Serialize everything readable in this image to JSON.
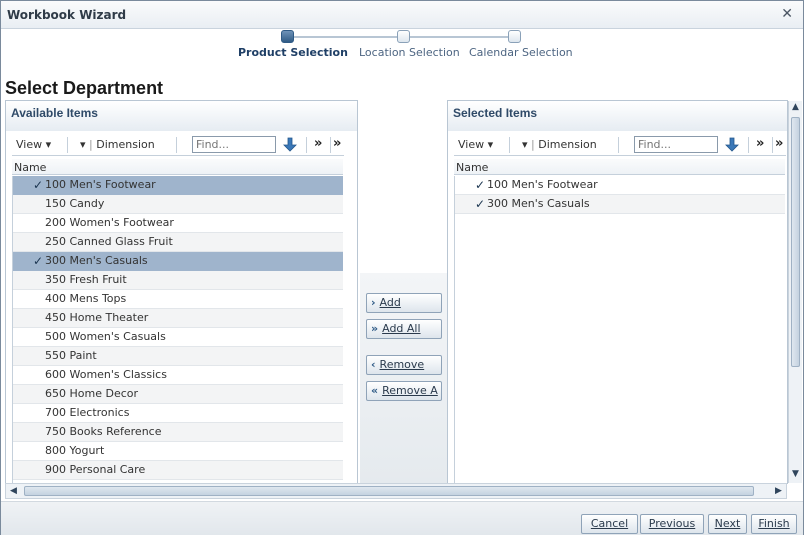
{
  "window": {
    "title": "Workbook Wizard",
    "close_symbol": "✕"
  },
  "train": {
    "steps": [
      {
        "label": "Product Selection",
        "active": true
      },
      {
        "label": "Location Selection",
        "active": false
      },
      {
        "label": "Calendar Selection",
        "active": false
      }
    ]
  },
  "page_title": "Select Department",
  "available": {
    "title": "Available Items",
    "toolbar": {
      "view": "View",
      "dimension": "Dimension",
      "find_placeholder": "Find...",
      "more": "»"
    },
    "column": "Name",
    "items": [
      {
        "label": "100 Men's Footwear",
        "checked": true
      },
      {
        "label": "150 Candy",
        "checked": false
      },
      {
        "label": "200 Women's Footwear",
        "checked": false
      },
      {
        "label": "250 Canned Glass Fruit",
        "checked": false
      },
      {
        "label": "300 Men's Casuals",
        "checked": true
      },
      {
        "label": "350 Fresh Fruit",
        "checked": false
      },
      {
        "label": "400 Mens Tops",
        "checked": false
      },
      {
        "label": "450 Home Theater",
        "checked": false
      },
      {
        "label": "500 Women's Casuals",
        "checked": false
      },
      {
        "label": "550 Paint",
        "checked": false
      },
      {
        "label": "600 Women's Classics",
        "checked": false
      },
      {
        "label": "650 Home Decor",
        "checked": false
      },
      {
        "label": "700 Electronics",
        "checked": false
      },
      {
        "label": "750 Books Reference",
        "checked": false
      },
      {
        "label": "800 Yogurt",
        "checked": false
      },
      {
        "label": "900 Personal Care",
        "checked": false
      }
    ]
  },
  "selected": {
    "title": "Selected Items",
    "toolbar": {
      "view": "View",
      "dimension": "Dimension",
      "find_placeholder": "Find...",
      "more": "»"
    },
    "column": "Name",
    "items": [
      {
        "label": "100 Men's Footwear"
      },
      {
        "label": "300 Men's Casuals"
      }
    ]
  },
  "shuttle": {
    "add": "Add",
    "add_all": "Add All",
    "remove": "Remove",
    "remove_all": "Remove A"
  },
  "footer": {
    "cancel": "Cancel",
    "previous": "Previous",
    "next": "Next",
    "finish": "Finish"
  },
  "colors": {
    "accent": "#2f5b86",
    "selected_row": "#9fb4cc"
  }
}
